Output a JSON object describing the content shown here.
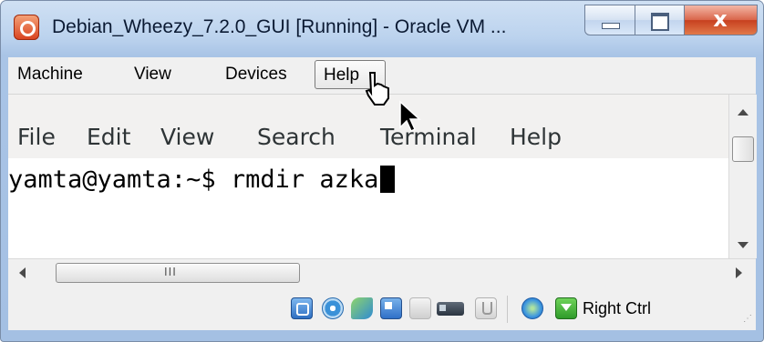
{
  "window": {
    "title": "Debian_Wheezy_7.2.0_GUI [Running] - Oracle VM ...",
    "controls": {
      "minimize": "minimize",
      "maximize": "maximize",
      "close": "x"
    }
  },
  "vbox_menu": {
    "items": [
      "Machine",
      "View",
      "Devices",
      "Help"
    ],
    "highlighted": "Help"
  },
  "terminal": {
    "menu": [
      "File",
      "Edit",
      "View",
      "Search",
      "Terminal",
      "Help"
    ],
    "prompt": "yamta@yamta:~$ ",
    "command": "rmdir azka"
  },
  "hscroll": {
    "grip": "III"
  },
  "statusbar": {
    "icons": [
      "hard-disk-icon",
      "optical-drive-icon",
      "usb-icon",
      "network-icon",
      "shared-folders-icon",
      "display-icon",
      "video-capture-icon",
      "guest-additions-icon",
      "mouse-integration-icon"
    ],
    "host_key": "Right Ctrl"
  },
  "colors": {
    "title_gradient": "#bcd3ee",
    "close": "#c7401f",
    "terminal_bg": "#ffffff",
    "menu_bg": "#f2f1f0"
  }
}
